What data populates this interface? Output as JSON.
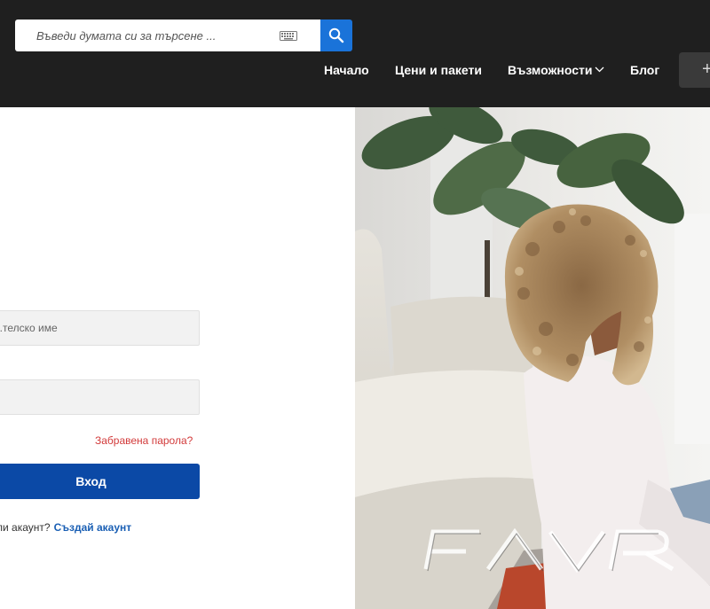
{
  "header": {
    "search": {
      "placeholder": "Въведи думата си за търсене ..."
    },
    "nav": [
      {
        "label": "Начало"
      },
      {
        "label": "Цени и пакети"
      },
      {
        "label": "Възможности"
      },
      {
        "label": "Блог"
      }
    ],
    "cta_label": "+"
  },
  "login": {
    "username_placeholder": "...телско име",
    "password_placeholder": "",
    "forgot_password": "Забравена парола?",
    "submit_label": "Вход",
    "signup_prompt": "...ли акаунт?",
    "signup_link": "Създай акаунт"
  },
  "hero": {
    "watermark": "FAVR"
  },
  "colors": {
    "header_bg": "#1f1f1f",
    "accent_blue": "#1a73d9",
    "button_blue": "#0b49a6",
    "link_red": "#d23a3a",
    "link_blue": "#1a5fb4"
  }
}
